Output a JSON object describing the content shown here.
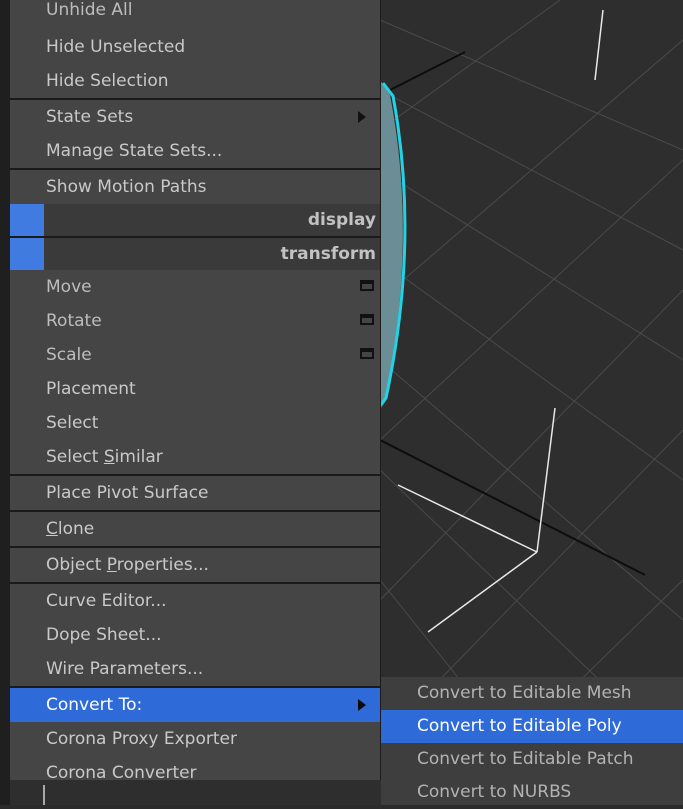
{
  "quad_menu": {
    "top_partial": "Unhide All",
    "display_section": {
      "items": [
        {
          "label": "Hide Unselected"
        },
        {
          "label": "Hide Selection"
        }
      ]
    },
    "state_section": {
      "items": [
        {
          "label": "State Sets",
          "submenu": true
        },
        {
          "label": "Manage State Sets..."
        }
      ]
    },
    "motion_section": {
      "items": [
        {
          "label": "Show Motion Paths"
        }
      ]
    },
    "headers": {
      "display": "display",
      "transform": "transform",
      "accent_color": "#3f7be0"
    },
    "transform_section": {
      "items": [
        {
          "label": "Move",
          "has_options": true
        },
        {
          "label": "Rotate",
          "has_options": true
        },
        {
          "label": "Scale",
          "has_options": true
        },
        {
          "label": "Placement"
        },
        {
          "label": "Select"
        },
        {
          "label_pre": "Select ",
          "label_u": "S",
          "label_post": "imilar"
        }
      ]
    },
    "pivot_section": {
      "items": [
        {
          "label": "Place Pivot Surface"
        }
      ]
    },
    "clone_section": {
      "items": [
        {
          "label_u": "C",
          "label_post": "lone"
        }
      ]
    },
    "props_section": {
      "items": [
        {
          "label_pre": "Object ",
          "label_u": "P",
          "label_post": "roperties..."
        }
      ]
    },
    "editor_section": {
      "items": [
        {
          "label": "Curve Editor..."
        },
        {
          "label": "Dope Sheet..."
        },
        {
          "label": "Wire Parameters..."
        }
      ]
    },
    "convert_section": {
      "items": [
        {
          "label": "Convert To:",
          "submenu": true,
          "highlighted": true
        },
        {
          "label": "Corona Proxy Exporter"
        },
        {
          "label": "Corona Converter"
        }
      ]
    }
  },
  "convert_submenu": {
    "items": [
      {
        "label": "Convert to Editable Mesh"
      },
      {
        "label": "Convert to Editable Poly",
        "selected": true
      },
      {
        "label": "Convert to Editable Patch"
      },
      {
        "label": "Convert to NURBS"
      }
    ]
  },
  "colors": {
    "highlight": "#2f6bd8",
    "selection_outline": "#22d3e6",
    "menu_bg": "#454545"
  }
}
